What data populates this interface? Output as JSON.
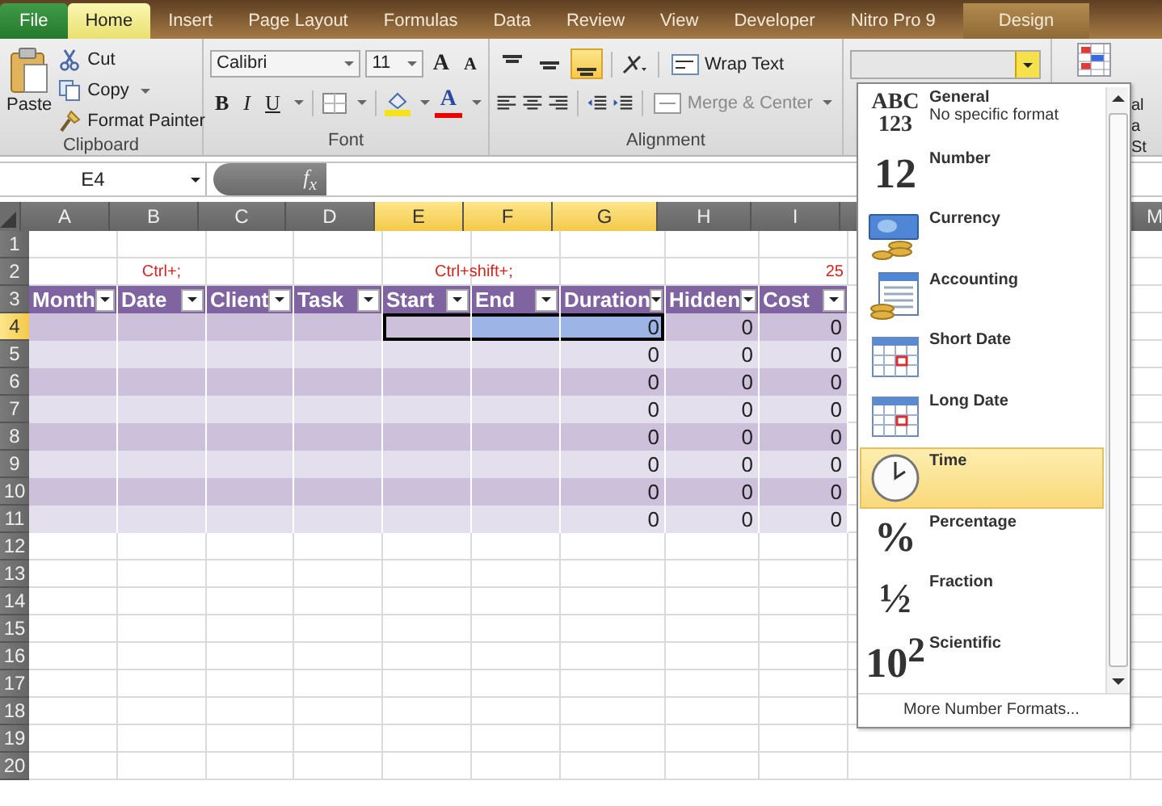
{
  "ribbon_tabs": [
    {
      "label": "File",
      "kind": "file",
      "selected": false
    },
    {
      "label": "Home",
      "kind": "tab",
      "selected": true
    },
    {
      "label": "Insert",
      "kind": "tab",
      "selected": false
    },
    {
      "label": "Page Layout",
      "kind": "tab",
      "selected": false
    },
    {
      "label": "Formulas",
      "kind": "tab",
      "selected": false
    },
    {
      "label": "Data",
      "kind": "tab",
      "selected": false
    },
    {
      "label": "Review",
      "kind": "tab",
      "selected": false
    },
    {
      "label": "View",
      "kind": "tab",
      "selected": false
    },
    {
      "label": "Developer",
      "kind": "tab",
      "selected": false
    },
    {
      "label": "Nitro Pro 9",
      "kind": "tab",
      "selected": false
    },
    {
      "label": "Design",
      "kind": "contextual",
      "selected": false
    }
  ],
  "clipboard": {
    "paste": "Paste",
    "label": "Clipboard",
    "commands": [
      {
        "label": "Cut",
        "kind": "cut"
      },
      {
        "label": "Copy",
        "kind": "copy"
      },
      {
        "label": "Format Painter",
        "kind": "painter"
      }
    ]
  },
  "font": {
    "family": "Calibri",
    "size": "11",
    "grow": "A",
    "shrink": "A",
    "color_glyph": "A",
    "label": "Font",
    "styles": [
      {
        "label": "B",
        "kind": "bold"
      },
      {
        "label": "I",
        "kind": "italic"
      },
      {
        "label": "U",
        "kind": "underline"
      }
    ]
  },
  "alignment": {
    "wrap": "Wrap Text",
    "merge": "Merge & Center",
    "merge_disabled": true,
    "label": "Alignment",
    "vertical": [
      {
        "kind": "top",
        "selected": false
      },
      {
        "kind": "middle",
        "selected": false
      },
      {
        "kind": "bottom",
        "selected": true
      }
    ]
  },
  "styles_partial": [
    "al",
    "a",
    "St"
  ],
  "formula_bar": {
    "name_box": "E4",
    "fx": "f$_{x}$"
  },
  "sheet": {
    "columns": [
      {
        "letter": "A",
        "selected": false
      },
      {
        "letter": "B",
        "selected": false
      },
      {
        "letter": "C",
        "selected": false
      },
      {
        "letter": "D",
        "selected": false
      },
      {
        "letter": "E",
        "selected": true
      },
      {
        "letter": "F",
        "selected": true
      },
      {
        "letter": "G",
        "selected": true
      },
      {
        "letter": "H",
        "selected": false
      },
      {
        "letter": "I",
        "selected": false
      },
      {
        "letter": "M",
        "selected": false
      }
    ],
    "rows": [
      {
        "number": "1",
        "selected": false,
        "kind": "plain"
      },
      {
        "number": "2",
        "selected": false,
        "kind": "plain",
        "cells": [
          {},
          {
            "text": "Ctrl+;"
          },
          {},
          {},
          {
            "text": "Ctrl+shift+;"
          },
          {},
          {},
          {},
          {
            "text": "25"
          }
        ]
      },
      {
        "number": "3",
        "selected": false,
        "kind": "header",
        "cells": [
          "Month",
          "Date",
          "Client",
          "Task",
          "Start",
          "End",
          "Duration",
          "Hidden",
          "Cost"
        ]
      },
      {
        "number": "4",
        "selected": true,
        "kind": "data",
        "striped": true,
        "cells": [
          {
            "selected": false
          },
          {
            "selected": false
          },
          {
            "selected": false
          },
          {
            "selected": false
          },
          {
            "selected": true
          },
          {
            "selected": true
          },
          {
            "selected": true,
            "text": "0"
          },
          {
            "selected": false,
            "text": "0"
          },
          {
            "selected": false,
            "text": "0"
          }
        ]
      },
      {
        "number": "5",
        "selected": false,
        "kind": "data",
        "striped": false,
        "cells": [
          {
            "selected": false
          },
          {
            "selected": false
          },
          {
            "selected": false
          },
          {
            "selected": false
          },
          {
            "selected": false
          },
          {
            "selected": false
          },
          {
            "selected": false,
            "text": "0"
          },
          {
            "selected": false,
            "text": "0"
          },
          {
            "selected": false,
            "text": "0"
          }
        ]
      },
      {
        "number": "6",
        "selected": false,
        "kind": "data",
        "striped": true,
        "cells": [
          {
            "selected": false
          },
          {
            "selected": false
          },
          {
            "selected": false
          },
          {
            "selected": false
          },
          {
            "selected": false
          },
          {
            "selected": false
          },
          {
            "selected": false,
            "text": "0"
          },
          {
            "selected": false,
            "text": "0"
          },
          {
            "selected": false,
            "text": "0"
          }
        ]
      },
      {
        "number": "7",
        "selected": false,
        "kind": "data",
        "striped": false,
        "cells": [
          {
            "selected": false
          },
          {
            "selected": false
          },
          {
            "selected": false
          },
          {
            "selected": false
          },
          {
            "selected": false
          },
          {
            "selected": false
          },
          {
            "selected": false,
            "text": "0"
          },
          {
            "selected": false,
            "text": "0"
          },
          {
            "selected": false,
            "text": "0"
          }
        ]
      },
      {
        "number": "8",
        "selected": false,
        "kind": "data",
        "striped": true,
        "cells": [
          {
            "selected": false
          },
          {
            "selected": false
          },
          {
            "selected": false
          },
          {
            "selected": false
          },
          {
            "selected": false
          },
          {
            "selected": false
          },
          {
            "selected": false,
            "text": "0"
          },
          {
            "selected": false,
            "text": "0"
          },
          {
            "selected": false,
            "text": "0"
          }
        ]
      },
      {
        "number": "9",
        "selected": false,
        "kind": "data",
        "striped": false,
        "cells": [
          {
            "selected": false
          },
          {
            "selected": false
          },
          {
            "selected": false
          },
          {
            "selected": false
          },
          {
            "selected": false
          },
          {
            "selected": false
          },
          {
            "selected": false,
            "text": "0"
          },
          {
            "selected": false,
            "text": "0"
          },
          {
            "selected": false,
            "text": "0"
          }
        ]
      },
      {
        "number": "10",
        "selected": false,
        "kind": "data",
        "striped": true,
        "cells": [
          {
            "selected": false
          },
          {
            "selected": false
          },
          {
            "selected": false
          },
          {
            "selected": false
          },
          {
            "selected": false
          },
          {
            "selected": false
          },
          {
            "selected": false,
            "text": "0"
          },
          {
            "selected": false,
            "text": "0"
          },
          {
            "selected": false,
            "text": "0"
          }
        ]
      },
      {
        "number": "11",
        "selected": false,
        "kind": "data",
        "striped": false,
        "cells": [
          {
            "selected": false
          },
          {
            "selected": false
          },
          {
            "selected": false
          },
          {
            "selected": false
          },
          {
            "selected": false
          },
          {
            "selected": false
          },
          {
            "selected": false,
            "text": "0"
          },
          {
            "selected": false,
            "text": "0"
          },
          {
            "selected": false,
            "text": "0"
          }
        ]
      },
      {
        "number": "12",
        "selected": false,
        "kind": "plain"
      },
      {
        "number": "13",
        "selected": false,
        "kind": "plain"
      },
      {
        "number": "14",
        "selected": false,
        "kind": "plain"
      },
      {
        "number": "15",
        "selected": false,
        "kind": "plain"
      },
      {
        "number": "16",
        "selected": false,
        "kind": "plain"
      },
      {
        "number": "17",
        "selected": false,
        "kind": "plain"
      },
      {
        "number": "18",
        "selected": false,
        "kind": "plain"
      },
      {
        "number": "19",
        "selected": false,
        "kind": "plain"
      },
      {
        "number": "20",
        "selected": false,
        "kind": "plain"
      }
    ]
  },
  "number_format_menu": {
    "footer": "More Number Formats...",
    "items": [
      {
        "label": "General",
        "detail": "No specific format",
        "glyph": [
          "ABC",
          "123"
        ],
        "selected": false
      },
      {
        "label": "Number",
        "glyph": [
          "12"
        ],
        "selected": false
      },
      {
        "label": "Currency",
        "selected": false
      },
      {
        "label": "Accounting",
        "selected": false
      },
      {
        "label": "Short Date",
        "selected": false
      },
      {
        "label": "Long Date",
        "selected": false
      },
      {
        "label": "Time",
        "selected": true
      },
      {
        "label": "Percentage",
        "glyph": [
          "%"
        ],
        "selected": false
      },
      {
        "label": "Fraction",
        "glyph": [
          "½"
        ],
        "selected": false
      },
      {
        "label": "Scientific",
        "glyph": [
          "10$^{2}$"
        ],
        "selected": false
      }
    ]
  }
}
